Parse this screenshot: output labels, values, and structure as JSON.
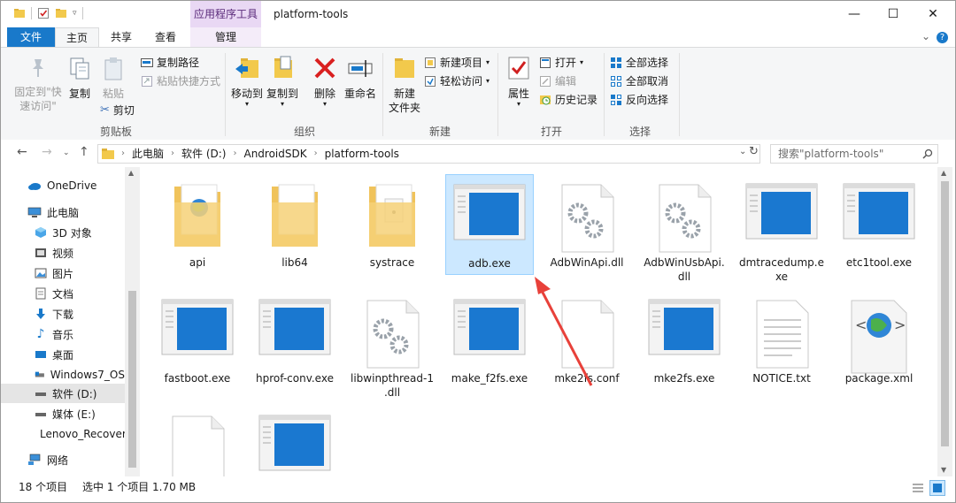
{
  "titlebar": {
    "context_tab": "应用程序工具",
    "title": "platform-tools",
    "minimize": "—",
    "maximize": "☐",
    "close": "✕"
  },
  "tabs": {
    "file": "文件",
    "home": "主页",
    "share": "共享",
    "view": "查看",
    "manage": "管理"
  },
  "ribbon": {
    "pin": "固定到\"快\n速访问\"",
    "copy": "复制",
    "paste": "粘贴",
    "copy_path": "复制路径",
    "paste_shortcut": "粘贴快捷方式",
    "cut": "剪切",
    "group_clipboard": "剪贴板",
    "move_to": "移动到",
    "copy_to": "复制到",
    "delete": "删除",
    "rename": "重命名",
    "group_organize": "组织",
    "new_folder": "新建\n文件夹",
    "new_item": "新建项目",
    "easy_access": "轻松访问",
    "group_new": "新建",
    "properties": "属性",
    "open": "打开",
    "edit": "编辑",
    "history": "历史记录",
    "group_open": "打开",
    "select_all": "全部选择",
    "select_none": "全部取消",
    "invert_selection": "反向选择",
    "group_select": "选择"
  },
  "address": {
    "crumbs": [
      "此电脑",
      "软件 (D:)",
      "AndroidSDK",
      "platform-tools"
    ],
    "search_placeholder": "搜索\"platform-tools\""
  },
  "nav": {
    "items": [
      {
        "label": "OneDrive",
        "icon": "cloud-icon"
      },
      {
        "label": "此电脑",
        "icon": "computer-icon"
      },
      {
        "label": "3D 对象",
        "icon": "cube-icon"
      },
      {
        "label": "视频",
        "icon": "video-icon"
      },
      {
        "label": "图片",
        "icon": "picture-icon"
      },
      {
        "label": "文档",
        "icon": "document-icon"
      },
      {
        "label": "下载",
        "icon": "download-icon"
      },
      {
        "label": "音乐",
        "icon": "music-icon"
      },
      {
        "label": "桌面",
        "icon": "desktop-icon"
      },
      {
        "label": "Windows7_OS",
        "icon": "drive-icon"
      },
      {
        "label": "软件 (D:)",
        "icon": "drive-icon"
      },
      {
        "label": "媒体 (E:)",
        "icon": "drive-icon"
      },
      {
        "label": "Lenovo_Recovery",
        "icon": "drive-icon"
      },
      {
        "label": "网络",
        "icon": "network-icon"
      }
    ]
  },
  "files": [
    {
      "name": "api",
      "type": "folder-web"
    },
    {
      "name": "lib64",
      "type": "folder"
    },
    {
      "name": "systrace",
      "type": "folder-doc"
    },
    {
      "name": "adb.exe",
      "type": "exe"
    },
    {
      "name": "AdbWinApi.dll",
      "type": "dll"
    },
    {
      "name": "AdbWinUsbApi.\ndll",
      "type": "dll"
    },
    {
      "name": "dmtracedump.e\nxe",
      "type": "exe"
    },
    {
      "name": "etc1tool.exe",
      "type": "exe"
    },
    {
      "name": "fastboot.exe",
      "type": "exe"
    },
    {
      "name": "hprof-conv.exe",
      "type": "exe"
    },
    {
      "name": "libwinpthread-1\n.dll",
      "type": "dll"
    },
    {
      "name": "make_f2fs.exe",
      "type": "exe"
    },
    {
      "name": "mke2fs.conf",
      "type": "blank"
    },
    {
      "name": "mke2fs.exe",
      "type": "exe"
    },
    {
      "name": "NOTICE.txt",
      "type": "txt"
    },
    {
      "name": "package.xml",
      "type": "xml"
    },
    {
      "name": "",
      "type": "blank"
    },
    {
      "name": "",
      "type": "exe"
    }
  ],
  "status": {
    "count": "18 个项目",
    "selected": "选中 1 个项目",
    "size": "1.70 MB"
  },
  "colors": {
    "accent": "#1979ca",
    "selection": "#cce8ff",
    "annotation_arrow": "#e8413a"
  }
}
